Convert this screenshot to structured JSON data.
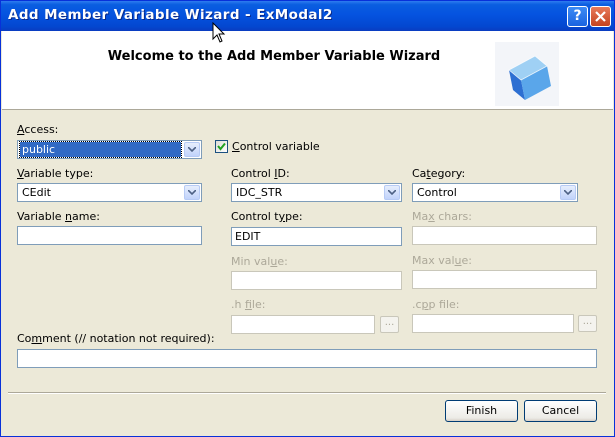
{
  "window": {
    "title": "Add Member Variable Wizard - ExModal2"
  },
  "title_buttons": {
    "help": "?"
  },
  "banner": {
    "title": "Welcome to the Add Member Variable Wizard"
  },
  "access": {
    "label_u": "A",
    "label_rest": "ccess:",
    "value": "public"
  },
  "control_variable": {
    "checked": true,
    "label_u": "C",
    "label_rest": "ontrol variable"
  },
  "variable_type": {
    "label_pre": "",
    "label_u": "V",
    "label_rest": "ariable type:",
    "value": "CEdit"
  },
  "control_id": {
    "label_pre": "Control ",
    "label_u": "I",
    "label_rest": "D:",
    "value": "IDC_STR"
  },
  "category": {
    "label_pre": "Ca",
    "label_u": "t",
    "label_rest": "egory:",
    "value": "Control"
  },
  "variable_name": {
    "label_pre": "Variable ",
    "label_u": "n",
    "label_rest": "ame:",
    "value": ""
  },
  "control_type": {
    "label_pre": "Control t",
    "label_u": "y",
    "label_rest": "pe:",
    "value": "EDIT"
  },
  "max_chars": {
    "label_pre": "Ma",
    "label_u": "x",
    "label_rest": " chars:",
    "value": ""
  },
  "min_value": {
    "label_pre": "Min val",
    "label_u": "u",
    "label_rest": "e:",
    "value": ""
  },
  "max_value": {
    "label_pre": "Max val",
    "label_u": "u",
    "label_rest": "e:",
    "value": ""
  },
  "h_file": {
    "label_pre": ".h ",
    "label_u": "f",
    "label_rest": "ile:",
    "value": "",
    "browse": "..."
  },
  "cpp_file": {
    "label_pre": ".c",
    "label_u": "p",
    "label_rest": "p file:",
    "value": "",
    "browse": "..."
  },
  "comment": {
    "label_pre": "Co",
    "label_u": "m",
    "label_rest": "ment (// notation not required):",
    "value": ""
  },
  "buttons": {
    "finish": "Finish",
    "cancel": "Cancel"
  },
  "colors": {
    "titlebar": "#0553e0",
    "dialog_bg": "#ece9d8",
    "selection": "#316ac5",
    "disabled_text": "#aca899"
  },
  "icons": {
    "banner": "blue-cube-icon",
    "dropdown": "chevron-down-icon",
    "check": "checkmark-icon"
  }
}
